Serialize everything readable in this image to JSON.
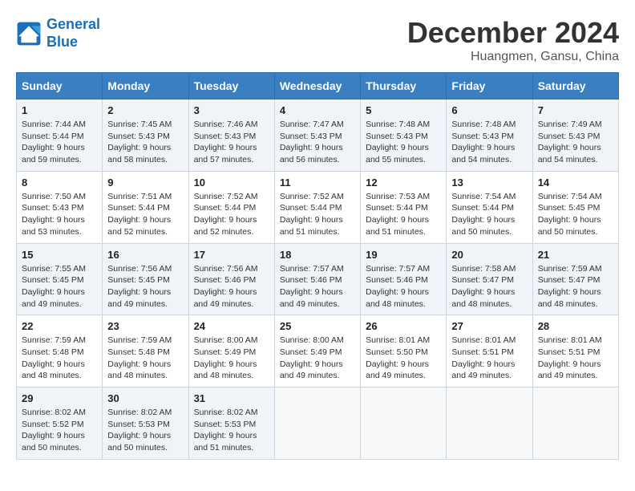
{
  "logo": {
    "line1": "General",
    "line2": "Blue"
  },
  "title": "December 2024",
  "subtitle": "Huangmen, Gansu, China",
  "weekdays": [
    "Sunday",
    "Monday",
    "Tuesday",
    "Wednesday",
    "Thursday",
    "Friday",
    "Saturday"
  ],
  "weeks": [
    [
      {
        "day": "1",
        "info": "Sunrise: 7:44 AM\nSunset: 5:44 PM\nDaylight: 9 hours\nand 59 minutes."
      },
      {
        "day": "2",
        "info": "Sunrise: 7:45 AM\nSunset: 5:43 PM\nDaylight: 9 hours\nand 58 minutes."
      },
      {
        "day": "3",
        "info": "Sunrise: 7:46 AM\nSunset: 5:43 PM\nDaylight: 9 hours\nand 57 minutes."
      },
      {
        "day": "4",
        "info": "Sunrise: 7:47 AM\nSunset: 5:43 PM\nDaylight: 9 hours\nand 56 minutes."
      },
      {
        "day": "5",
        "info": "Sunrise: 7:48 AM\nSunset: 5:43 PM\nDaylight: 9 hours\nand 55 minutes."
      },
      {
        "day": "6",
        "info": "Sunrise: 7:48 AM\nSunset: 5:43 PM\nDaylight: 9 hours\nand 54 minutes."
      },
      {
        "day": "7",
        "info": "Sunrise: 7:49 AM\nSunset: 5:43 PM\nDaylight: 9 hours\nand 54 minutes."
      }
    ],
    [
      {
        "day": "8",
        "info": "Sunrise: 7:50 AM\nSunset: 5:43 PM\nDaylight: 9 hours\nand 53 minutes."
      },
      {
        "day": "9",
        "info": "Sunrise: 7:51 AM\nSunset: 5:44 PM\nDaylight: 9 hours\nand 52 minutes."
      },
      {
        "day": "10",
        "info": "Sunrise: 7:52 AM\nSunset: 5:44 PM\nDaylight: 9 hours\nand 52 minutes."
      },
      {
        "day": "11",
        "info": "Sunrise: 7:52 AM\nSunset: 5:44 PM\nDaylight: 9 hours\nand 51 minutes."
      },
      {
        "day": "12",
        "info": "Sunrise: 7:53 AM\nSunset: 5:44 PM\nDaylight: 9 hours\nand 51 minutes."
      },
      {
        "day": "13",
        "info": "Sunrise: 7:54 AM\nSunset: 5:44 PM\nDaylight: 9 hours\nand 50 minutes."
      },
      {
        "day": "14",
        "info": "Sunrise: 7:54 AM\nSunset: 5:45 PM\nDaylight: 9 hours\nand 50 minutes."
      }
    ],
    [
      {
        "day": "15",
        "info": "Sunrise: 7:55 AM\nSunset: 5:45 PM\nDaylight: 9 hours\nand 49 minutes."
      },
      {
        "day": "16",
        "info": "Sunrise: 7:56 AM\nSunset: 5:45 PM\nDaylight: 9 hours\nand 49 minutes."
      },
      {
        "day": "17",
        "info": "Sunrise: 7:56 AM\nSunset: 5:46 PM\nDaylight: 9 hours\nand 49 minutes."
      },
      {
        "day": "18",
        "info": "Sunrise: 7:57 AM\nSunset: 5:46 PM\nDaylight: 9 hours\nand 49 minutes."
      },
      {
        "day": "19",
        "info": "Sunrise: 7:57 AM\nSunset: 5:46 PM\nDaylight: 9 hours\nand 48 minutes."
      },
      {
        "day": "20",
        "info": "Sunrise: 7:58 AM\nSunset: 5:47 PM\nDaylight: 9 hours\nand 48 minutes."
      },
      {
        "day": "21",
        "info": "Sunrise: 7:59 AM\nSunset: 5:47 PM\nDaylight: 9 hours\nand 48 minutes."
      }
    ],
    [
      {
        "day": "22",
        "info": "Sunrise: 7:59 AM\nSunset: 5:48 PM\nDaylight: 9 hours\nand 48 minutes."
      },
      {
        "day": "23",
        "info": "Sunrise: 7:59 AM\nSunset: 5:48 PM\nDaylight: 9 hours\nand 48 minutes."
      },
      {
        "day": "24",
        "info": "Sunrise: 8:00 AM\nSunset: 5:49 PM\nDaylight: 9 hours\nand 48 minutes."
      },
      {
        "day": "25",
        "info": "Sunrise: 8:00 AM\nSunset: 5:49 PM\nDaylight: 9 hours\nand 49 minutes."
      },
      {
        "day": "26",
        "info": "Sunrise: 8:01 AM\nSunset: 5:50 PM\nDaylight: 9 hours\nand 49 minutes."
      },
      {
        "day": "27",
        "info": "Sunrise: 8:01 AM\nSunset: 5:51 PM\nDaylight: 9 hours\nand 49 minutes."
      },
      {
        "day": "28",
        "info": "Sunrise: 8:01 AM\nSunset: 5:51 PM\nDaylight: 9 hours\nand 49 minutes."
      }
    ],
    [
      {
        "day": "29",
        "info": "Sunrise: 8:02 AM\nSunset: 5:52 PM\nDaylight: 9 hours\nand 50 minutes."
      },
      {
        "day": "30",
        "info": "Sunrise: 8:02 AM\nSunset: 5:53 PM\nDaylight: 9 hours\nand 50 minutes."
      },
      {
        "day": "31",
        "info": "Sunrise: 8:02 AM\nSunset: 5:53 PM\nDaylight: 9 hours\nand 51 minutes."
      },
      {
        "day": "",
        "info": ""
      },
      {
        "day": "",
        "info": ""
      },
      {
        "day": "",
        "info": ""
      },
      {
        "day": "",
        "info": ""
      }
    ]
  ]
}
